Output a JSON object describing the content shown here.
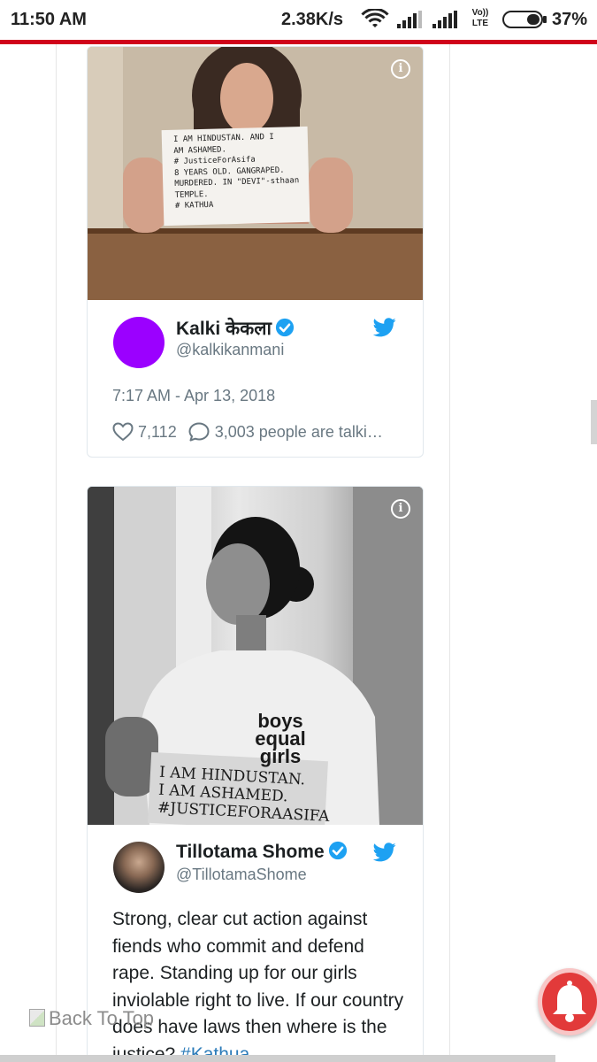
{
  "status_bar": {
    "time": "11:50 AM",
    "network_speed": "2.38K/s",
    "volte_line1": "Vo))",
    "volte_line2": "LTE",
    "battery_percent": "37%",
    "icons": [
      "wifi-icon",
      "signal-icon",
      "signal-icon",
      "battery-icon"
    ]
  },
  "colors": {
    "accent_red": "#d0021b",
    "twitter_blue": "#1da1f2",
    "link_blue": "#2b7bb9",
    "secondary_text": "#697882",
    "avatar_purple": "#9b00ff"
  },
  "tweets": [
    {
      "display_name": "Kalki केकला",
      "handle": "@kalkikanmani",
      "timestamp": "7:17 AM - Apr 13, 2018",
      "likes": "7,112",
      "replies_text": "3,003 people are talki…",
      "media_sign_lines": [
        "I AM HINDUSTAN. AND I",
        "AM ASHAMED.",
        "# JusticeForAsifa",
        "8 YEARS OLD. GANGRAPED.",
        "MURDERED. IN \"DEVI\"-sthaan",
        "TEMPLE.",
        "# KATHUA"
      ]
    },
    {
      "display_name": "Tillotama Shome",
      "handle": "@TillotamaShome",
      "text": "Strong, clear cut action against fiends who commit and defend rape. Standing up for our girls inviolable right to live. If our country does have laws then where is the justice?",
      "hashtag": "#Kathua",
      "media_shirt_lines": [
        "boys",
        "equal",
        "girls"
      ],
      "media_sign_lines": [
        "I AM HINDUSTAN.",
        "I AM ASHAMED.",
        "#JUSTICEFORAASIFA"
      ]
    }
  ],
  "back_to_top": "Back To Top"
}
